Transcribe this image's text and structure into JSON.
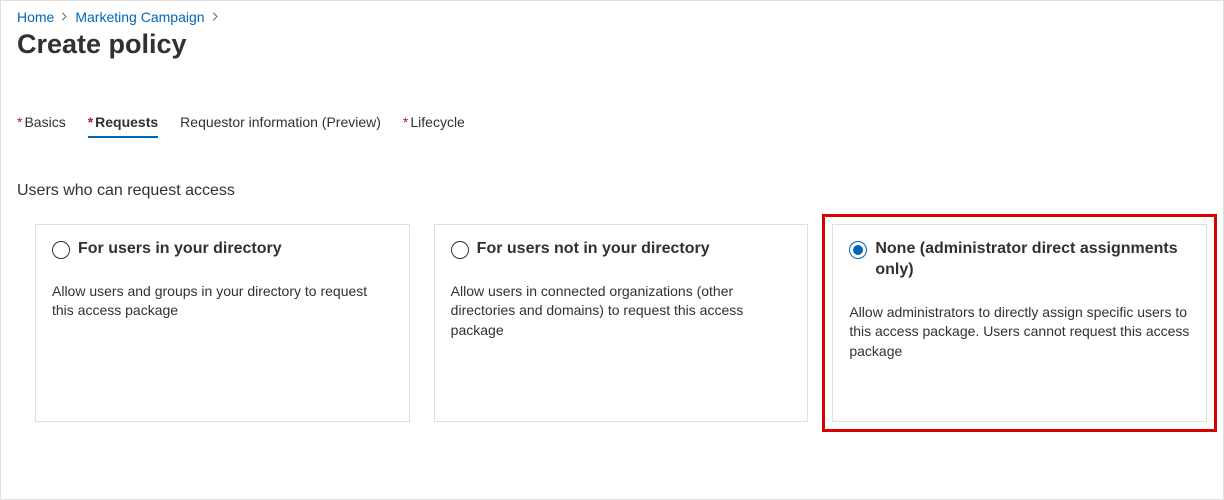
{
  "breadcrumb": {
    "items": [
      {
        "label": "Home"
      },
      {
        "label": "Marketing Campaign"
      }
    ]
  },
  "page": {
    "title": "Create policy"
  },
  "tabs": [
    {
      "label": "Basics",
      "required": true,
      "active": false
    },
    {
      "label": "Requests",
      "required": true,
      "active": true
    },
    {
      "label": "Requestor information (Preview)",
      "required": false,
      "active": false
    },
    {
      "label": "Lifecycle",
      "required": true,
      "active": false
    }
  ],
  "section": {
    "heading": "Users who can request access"
  },
  "options": [
    {
      "title": "For users in your directory",
      "description": "Allow users and groups in your directory to request this access package",
      "selected": false,
      "highlighted": false
    },
    {
      "title": "For users not in your directory",
      "description": "Allow users in connected organizations (other directories and domains) to request this access package",
      "selected": false,
      "highlighted": false
    },
    {
      "title": "None (administrator direct assignments only)",
      "description": "Allow administrators to directly assign specific users to this access package. Users cannot request this access package",
      "selected": true,
      "highlighted": true
    }
  ],
  "required_marker": "*"
}
